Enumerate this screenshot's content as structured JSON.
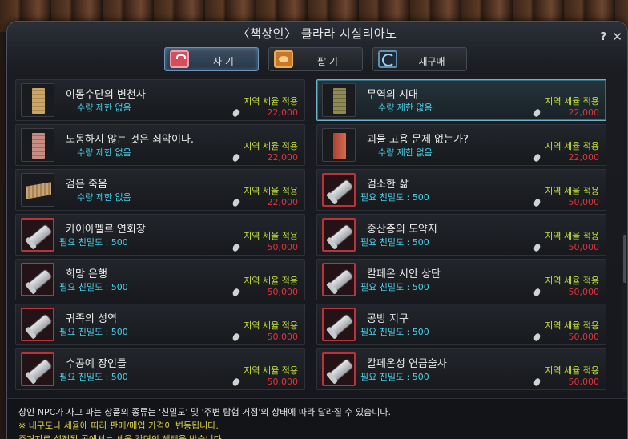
{
  "window": {
    "title": "〈책상인〉 클라라 시실리아노",
    "help": "?",
    "close": "✕"
  },
  "tabs": [
    {
      "label": "사 기",
      "icon": "bag-icon",
      "active": true
    },
    {
      "label": "팔 기",
      "icon": "coins-icon",
      "active": false
    },
    {
      "label": "재구매",
      "icon": "cycle-icon",
      "active": false
    }
  ],
  "items": [
    {
      "name": "이동수단의 변천사",
      "sub": "수량 제한 없음",
      "tax": "지역 세율 적용",
      "price": "22,000",
      "thumb": "book-tan",
      "frame": "plain",
      "selected": false
    },
    {
      "name": "무역의 시대",
      "sub": "수량 제한 없음",
      "tax": "지역 세율 적용",
      "price": "22,000",
      "thumb": "book-olive",
      "frame": "plain",
      "selected": true
    },
    {
      "name": "노동하지 않는 것은 죄악이다.",
      "sub": "수량 제한 없음",
      "tax": "지역 세율 적용",
      "price": "22,000",
      "thumb": "book-rose",
      "frame": "plain",
      "selected": false
    },
    {
      "name": "괴물 고용 문제 없는가?",
      "sub": "수량 제한 없음",
      "tax": "지역 세율 적용",
      "price": "22,000",
      "thumb": "book-brick",
      "frame": "plain",
      "selected": false
    },
    {
      "name": "검은 죽음",
      "sub": "수량 제한 없음",
      "tax": "지역 세율 적용",
      "price": "22,000",
      "thumb": "book-open",
      "frame": "plain",
      "selected": false
    },
    {
      "name": "검소한 삶",
      "sub": "필요 친밀도 : 500",
      "tax": "지역 세율 적용",
      "price": "50,000",
      "thumb": "scroll",
      "frame": "red",
      "selected": false
    },
    {
      "name": "카이아펠르 연회장",
      "sub": "필요 친밀도 : 500",
      "tax": "지역 세율 적용",
      "price": "50,000",
      "thumb": "scroll",
      "frame": "red",
      "selected": false
    },
    {
      "name": "중산층의 도약지",
      "sub": "필요 친밀도 : 500",
      "tax": "지역 세율 적용",
      "price": "50,000",
      "thumb": "scroll",
      "frame": "red",
      "selected": false
    },
    {
      "name": "희망 은행",
      "sub": "필요 친밀도 : 500",
      "tax": "지역 세율 적용",
      "price": "50,000",
      "thumb": "scroll",
      "frame": "red",
      "selected": false
    },
    {
      "name": "칼페온 시안 상단",
      "sub": "필요 친밀도 : 500",
      "tax": "지역 세율 적용",
      "price": "50,000",
      "thumb": "scroll",
      "frame": "red",
      "selected": false
    },
    {
      "name": "귀족의 성역",
      "sub": "필요 친밀도 : 500",
      "tax": "지역 세율 적용",
      "price": "50,000",
      "thumb": "scroll",
      "frame": "red",
      "selected": false
    },
    {
      "name": "공방 지구",
      "sub": "필요 친밀도 : 500",
      "tax": "지역 세율 적용",
      "price": "50,000",
      "thumb": "scroll",
      "frame": "red",
      "selected": false
    },
    {
      "name": "수공예 장인들",
      "sub": "필요 친밀도 : 500",
      "tax": "지역 세율 적용",
      "price": "50,000",
      "thumb": "scroll",
      "frame": "red",
      "selected": false
    },
    {
      "name": "칼페온성 연금술사",
      "sub": "필요 친밀도 : 500",
      "tax": "지역 세율 적용",
      "price": "50,000",
      "thumb": "scroll",
      "frame": "red",
      "selected": false
    }
  ],
  "footer": {
    "line1": "상인 NPC가 사고 파는 상품의 종류는 '친밀도' 및 '주변 탐험 거점'의 상태에 따라 달라질 수 있습니다.",
    "line2": "※ 내구도나 세율에 따라 판매/매입 가격이 변동됩니다.",
    "line3": "주거지로 설정된 곳에서는 세율 감면의 혜택을 받습니다."
  },
  "colors": {
    "tax": "#c6e03c",
    "price": "#e2333b",
    "sub": "#4ad0e8",
    "selected_border": "#6fb2c9"
  }
}
